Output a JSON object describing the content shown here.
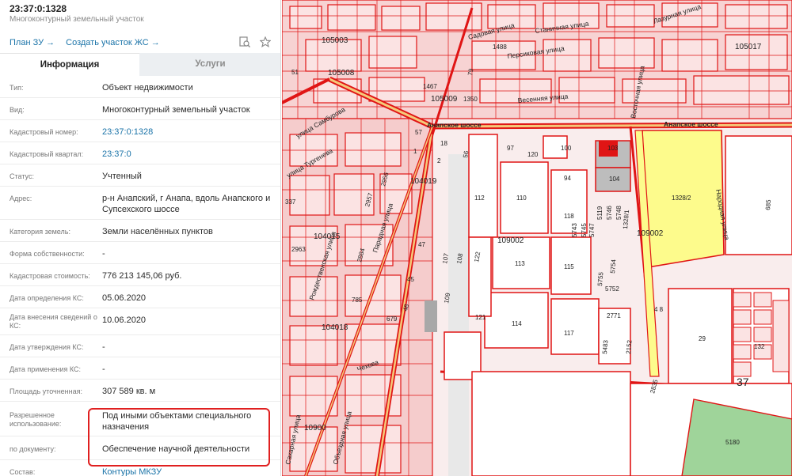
{
  "header": {
    "title": "23:37:0:1328",
    "subtitle": "Многоконтурный земельный участок",
    "link_plan": "План ЗУ →",
    "link_create": "Создать участок ЖС →"
  },
  "tabs": [
    {
      "label": "Информация",
      "active": true
    },
    {
      "label": "Услуги",
      "active": false
    }
  ],
  "rows": [
    {
      "label": "Тип:",
      "value": "Объект недвижимости"
    },
    {
      "label": "Вид:",
      "value": "Многоконтурный земельный участок"
    },
    {
      "label": "Кадастровый номер:",
      "value": "23:37:0:1328"
    },
    {
      "label": "Кадастровый квартал:",
      "value": "23:37:0"
    },
    {
      "label": "Статус:",
      "value": "Учтенный"
    },
    {
      "label": "Адрес:",
      "value": "р-н Анапский, г Анапа, вдоль Анапского и Супсехского шоссе"
    },
    {
      "label": "Категория земель:",
      "value": "Земли населённых пунктов"
    },
    {
      "label": "Форма собственности:",
      "value": "-"
    },
    {
      "label": "Кадастровая стоимость:",
      "value": "776 213 145,06 руб."
    },
    {
      "label": "Дата определения КС:",
      "value": "05.06.2020"
    },
    {
      "label": "Дата внесения сведений о КС:",
      "value": "10.06.2020"
    },
    {
      "label": "Дата утверждения КС:",
      "value": "-"
    },
    {
      "label": "Дата применения КС:",
      "value": "-"
    },
    {
      "label": "Площадь уточненная:",
      "value": "307 589 кв. м"
    },
    {
      "label": "Разрешенное использование:",
      "value": "Под иными объектами специального назначения"
    },
    {
      "label": "по документу:",
      "value": "Обеспечение научной деятельности"
    },
    {
      "label": "Состав:",
      "value": "Контуры МКЗУ"
    }
  ],
  "map": {
    "streets": [
      "Анапское шоссе",
      "Анапское шоссе",
      "Садовая улица",
      "Станичная улица",
      "Персиковая улица",
      "Весенняя улица",
      "Лазурная улица",
      "Восточная улица",
      "Народная улица",
      "Парадная улица",
      "Рождественская улица",
      "Объездная улица",
      "Сахарная улица",
      "Чехова",
      "улица Тургенева",
      "улица Самбурова"
    ],
    "quarters": [
      "105003",
      "105009",
      "105008",
      "104019",
      "104015",
      "104018",
      "10900",
      "109002",
      "109002",
      "105017"
    ],
    "parcels": [
      "1488",
      "1467",
      "1350",
      "100",
      "103",
      "120",
      "97",
      "94",
      "104",
      "110",
      "112",
      "118",
      "1328/2",
      "1328/1",
      "113",
      "115",
      "114",
      "117",
      "2771",
      "29",
      "132",
      "5180",
      "121",
      "109",
      "108",
      "107",
      "122",
      "5752",
      "5755",
      "5754",
      "5483",
      "2152",
      "4 8",
      "2835",
      "685",
      "37",
      "337",
      "2963",
      "2884",
      "2956",
      "2957",
      "45",
      "47",
      "48",
      "679",
      "785",
      "51",
      "57",
      "1",
      "2",
      "18",
      "56",
      "79",
      "5743",
      "5745",
      "5747",
      "5119",
      "5746",
      "5748"
    ]
  }
}
